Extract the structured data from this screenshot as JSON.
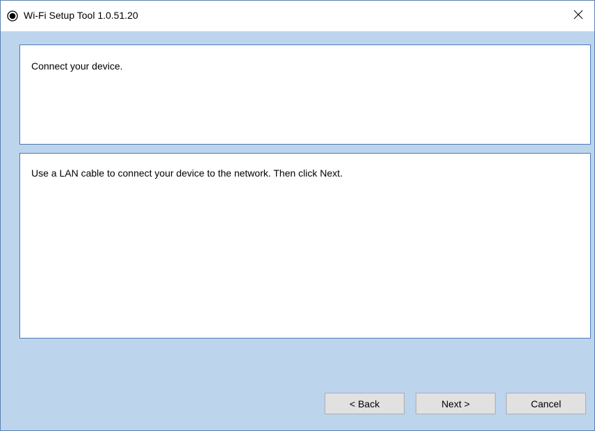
{
  "window": {
    "title": "Wi-Fi Setup Tool 1.0.51.20",
    "icon": "app-radio-icon",
    "close_icon": "close-icon"
  },
  "header_panel": {
    "text": "Connect your device."
  },
  "body_panel": {
    "text": "Use a LAN cable to connect your device to the network. Then click Next."
  },
  "buttons": {
    "back_label": "< Back",
    "next_label": "Next >",
    "cancel_label": "Cancel"
  },
  "colors": {
    "window_background": "#bcd4ec",
    "panel_border": "#4d79b4",
    "button_face": "#e1e1e1"
  }
}
